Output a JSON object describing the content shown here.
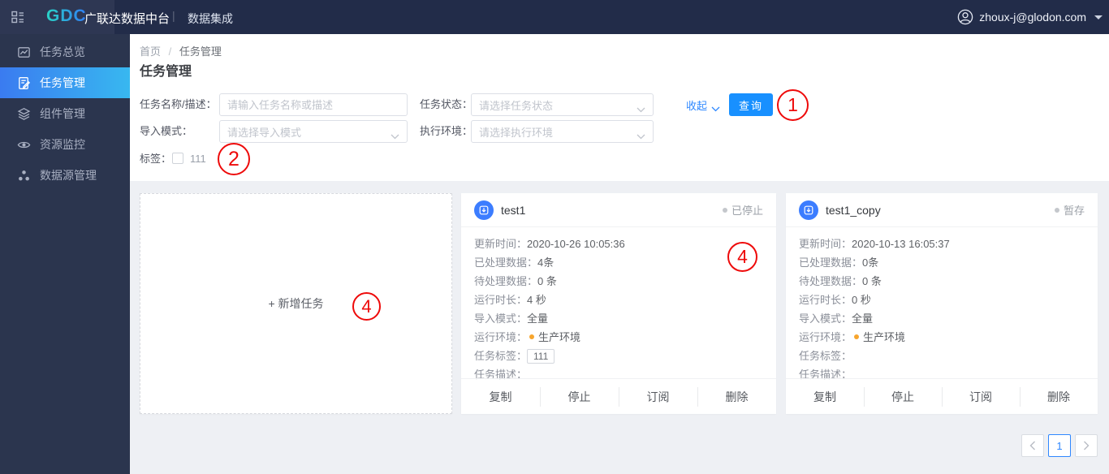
{
  "topbar": {
    "logo": "GDC",
    "product_name": "广联达数据中台",
    "divider": "|",
    "nav_item": "数据集成",
    "user_email": "zhoux-j@glodon.com"
  },
  "sidebar": {
    "items": [
      {
        "label": "任务总览",
        "icon": "task-overview-icon",
        "active": false
      },
      {
        "label": "任务管理",
        "icon": "task-manage-icon",
        "active": true
      },
      {
        "label": "组件管理",
        "icon": "components-icon",
        "active": false
      },
      {
        "label": "资源监控",
        "icon": "resource-monitor-icon",
        "active": false
      },
      {
        "label": "数据源管理",
        "icon": "datasource-icon",
        "active": false
      }
    ]
  },
  "breadcrumb": {
    "home": "首页",
    "separator": "/",
    "current": "任务管理"
  },
  "page_title": "任务管理",
  "filters": {
    "name": {
      "label": "任务名称/描述：",
      "placeholder": "请输入任务名称或描述"
    },
    "status": {
      "label": "任务状态：",
      "placeholder": "请选择任务状态"
    },
    "import_mode": {
      "label": "导入模式：",
      "placeholder": "请选择导入模式"
    },
    "env": {
      "label": "执行环境：",
      "placeholder": "请选择执行环境"
    },
    "tag": {
      "label": "标签：",
      "option": "111",
      "checked": false
    },
    "collapse_link": "收起",
    "search_button": "查询"
  },
  "add_card": {
    "label": "+ 新增任务"
  },
  "tasks": [
    {
      "title": "test1",
      "status": "已停止",
      "rows": {
        "update_time": {
          "label": "更新时间：",
          "value": "2020-10-26 10:05:36"
        },
        "processed": {
          "label": "已处理数据：",
          "value": "4条"
        },
        "pending": {
          "label": "待处理数据：",
          "value": "0 条"
        },
        "duration": {
          "label": "运行时长：",
          "value": "4 秒"
        },
        "import_mode": {
          "label": "导入模式：",
          "value": "全量"
        },
        "env": {
          "label": "运行环境：",
          "value": "生产环境"
        },
        "tag": {
          "label": "任务标签：",
          "value": "111"
        },
        "desc": {
          "label": "任务描述：",
          "value": ""
        }
      },
      "actions": {
        "copy": "复制",
        "stop": "停止",
        "subscribe": "订阅",
        "delete": "删除"
      }
    },
    {
      "title": "test1_copy",
      "status": "暂存",
      "rows": {
        "update_time": {
          "label": "更新时间：",
          "value": "2020-10-13 16:05:37"
        },
        "processed": {
          "label": "已处理数据：",
          "value": "0条"
        },
        "pending": {
          "label": "待处理数据：",
          "value": "0 条"
        },
        "duration": {
          "label": "运行时长：",
          "value": "0 秒"
        },
        "import_mode": {
          "label": "导入模式：",
          "value": "全量"
        },
        "env": {
          "label": "运行环境：",
          "value": "生产环境"
        },
        "tag": {
          "label": "任务标签：",
          "value": ""
        },
        "desc": {
          "label": "任务描述：",
          "value": ""
        }
      },
      "actions": {
        "copy": "复制",
        "stop": "停止",
        "subscribe": "订阅",
        "delete": "删除"
      }
    }
  ],
  "pagination": {
    "current_page": "1"
  },
  "annotations": [
    {
      "label": "1"
    },
    {
      "label": "2"
    },
    {
      "label": "4"
    },
    {
      "label": "4"
    }
  ],
  "colors": {
    "topbar_bg": "#222c49",
    "sidebar_bg": "#2b354e",
    "accent_blue": "#1890ff",
    "link_blue": "#2f88ff",
    "sidebar_active_gradient_start": "#3a7bf0",
    "sidebar_active_gradient_end": "#38b8f0",
    "annotation_red": "#ee0a0a",
    "env_dot_orange": "#f7a52d",
    "status_dot_gray": "#c4c7cc"
  }
}
